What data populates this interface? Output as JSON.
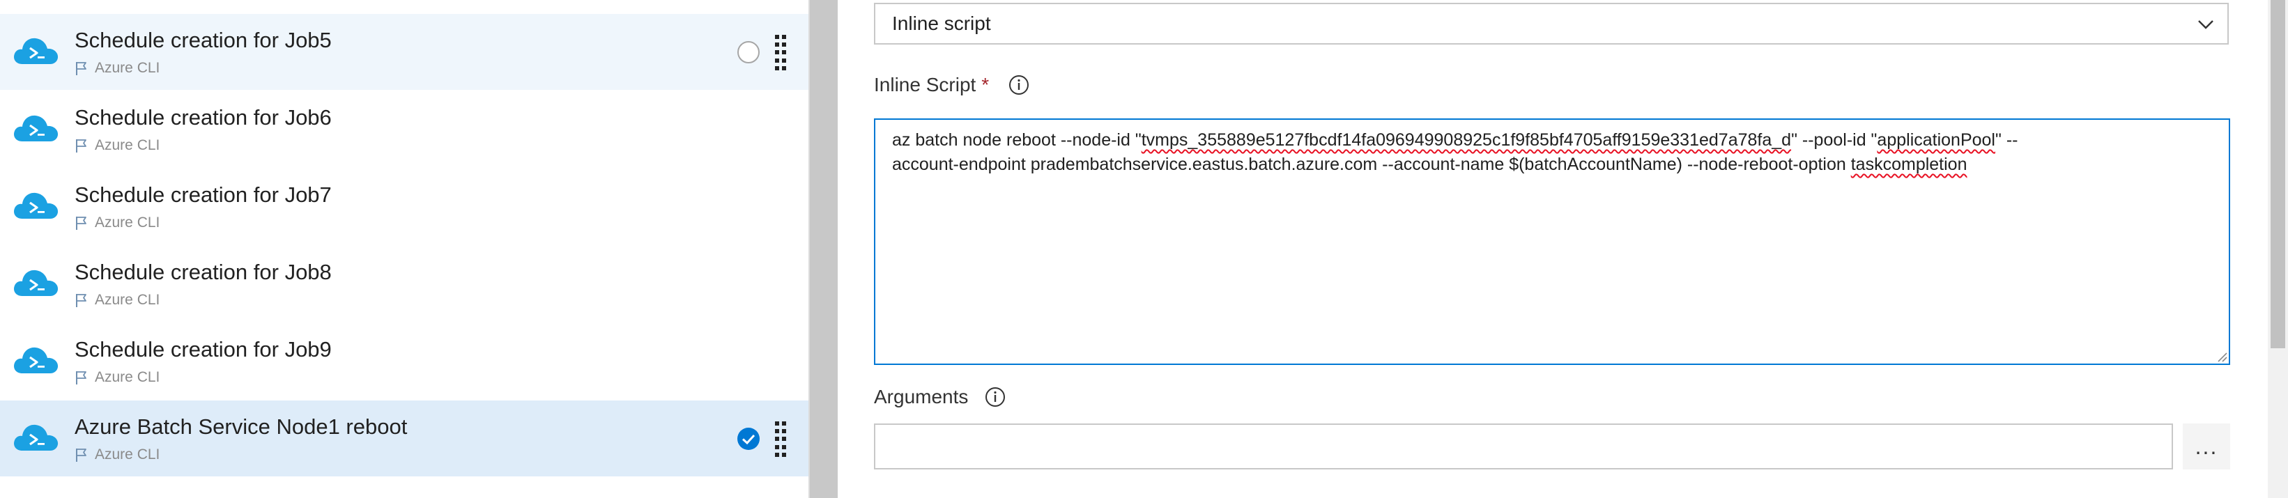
{
  "tasks": [
    {
      "title": "Schedule creation for Job5",
      "subtitle": "Azure CLI",
      "state": "hover"
    },
    {
      "title": "Schedule creation for Job6",
      "subtitle": "Azure CLI",
      "state": "normal"
    },
    {
      "title": "Schedule creation for Job7",
      "subtitle": "Azure CLI",
      "state": "normal"
    },
    {
      "title": "Schedule creation for Job8",
      "subtitle": "Azure CLI",
      "state": "normal"
    },
    {
      "title": "Schedule creation for Job9",
      "subtitle": "Azure CLI",
      "state": "normal"
    },
    {
      "title": "Azure Batch Service Node1 reboot",
      "subtitle": "Azure CLI",
      "state": "selected"
    }
  ],
  "form": {
    "script_location_value": "Inline script",
    "inline_script_label": "Inline Script",
    "required_marker": "*",
    "inline_script_lines": [
      [
        "az batch node reboot --node-id \"",
        {
          "t": "tvmps_355889e5127fbcdf14fa096949908925c1f9f85bf4705aff9159e331ed7a78fa_d",
          "sq": true
        },
        "\" --pool-id \"",
        {
          "t": "applicationPool",
          "sq": true
        },
        "\" --"
      ],
      [
        "account-endpoint pradembatchservice.eastus.batch.azure.com --account-name $(batchAccountName) --node-reboot-option ",
        {
          "t": "taskcompletion",
          "sq": true
        }
      ]
    ],
    "arguments_label": "Arguments",
    "arguments_value": "",
    "more_button_label": "..."
  },
  "colors": {
    "accent": "#0078d4",
    "selected_row": "#deecf9",
    "hover_row": "#eff6fc",
    "cloud_icon": "#1ba1e2",
    "required": "#a4262c"
  },
  "icons": {
    "task": "azure-cli-cloud-icon",
    "subtitle": "flag-icon",
    "info": "info-icon",
    "chevron": "chevron-down-icon",
    "check": "checkmark-circle-icon"
  }
}
